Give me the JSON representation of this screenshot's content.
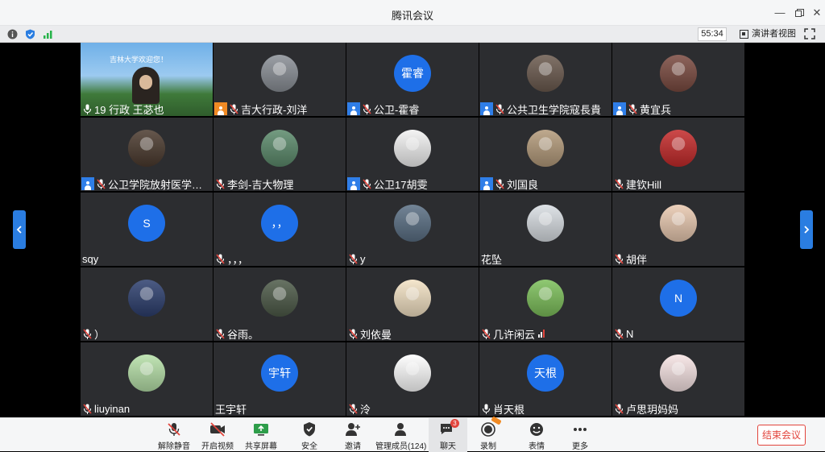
{
  "window": {
    "title": "腾讯会议"
  },
  "statusbar": {
    "timer": "55:34",
    "speaker_view_label": "演讲者视图"
  },
  "participants": [
    {
      "name": "19 行政 王苾也",
      "avatar_text": "",
      "avatar_kind": "video",
      "badge": "none",
      "mic": "on",
      "avatar_color": "#4a86c6",
      "video_banner": "吉林大学欢迎您！"
    },
    {
      "name": "吉大行政-刘洋",
      "avatar_text": "",
      "avatar_kind": "photo",
      "badge": "orange",
      "mic": "muted",
      "avatar_color": "#8a8f96"
    },
    {
      "name": "公卫-霍睿",
      "avatar_text": "霍睿",
      "avatar_kind": "text",
      "badge": "blue",
      "mic": "muted",
      "avatar_color": "#1e6fe8"
    },
    {
      "name": "公共卫生学院寇長貴",
      "avatar_text": "",
      "avatar_kind": "photo",
      "badge": "blue",
      "mic": "muted",
      "avatar_color": "#6b5a4e"
    },
    {
      "name": "黄宜兵",
      "avatar_text": "",
      "avatar_kind": "photo",
      "badge": "blue",
      "mic": "muted",
      "avatar_color": "#7a4a40"
    },
    {
      "name": "公卫学院放射医学…",
      "avatar_text": "",
      "avatar_kind": "photo",
      "badge": "blue",
      "mic": "muted",
      "avatar_color": "#4b3a2e"
    },
    {
      "name": "李剑-吉大物理",
      "avatar_text": "",
      "avatar_kind": "photo",
      "badge": "none",
      "mic": "muted",
      "avatar_color": "#5b8a6b"
    },
    {
      "name": "公卫17胡雯",
      "avatar_text": "",
      "avatar_kind": "photo",
      "badge": "blue",
      "mic": "muted",
      "avatar_color": "#f2f2f2"
    },
    {
      "name": "刘国良",
      "avatar_text": "",
      "avatar_kind": "photo",
      "badge": "blue",
      "mic": "muted",
      "avatar_color": "#b39a7a"
    },
    {
      "name": "建钦Hill",
      "avatar_text": "",
      "avatar_kind": "photo",
      "badge": "none",
      "mic": "muted",
      "avatar_color": "#c42a2a"
    },
    {
      "name": "sqy",
      "avatar_text": "S",
      "avatar_kind": "text",
      "badge": "none",
      "mic": "none",
      "avatar_color": "#1e6fe8"
    },
    {
      "name": "，，，",
      "avatar_text": "，，",
      "avatar_kind": "text",
      "badge": "none",
      "mic": "muted",
      "avatar_color": "#1e6fe8"
    },
    {
      "name": "y",
      "avatar_text": "",
      "avatar_kind": "photo",
      "badge": "none",
      "mic": "muted",
      "avatar_color": "#5a6f84"
    },
    {
      "name": "花坠",
      "avatar_text": "",
      "avatar_kind": "photo",
      "badge": "none",
      "mic": "none",
      "avatar_color": "#d9dee3"
    },
    {
      "name": "胡伴",
      "avatar_text": "",
      "avatar_kind": "photo",
      "badge": "none",
      "mic": "muted",
      "avatar_color": "#e9c9b0"
    },
    {
      "name": "）",
      "avatar_text": "",
      "avatar_kind": "photo",
      "badge": "none",
      "mic": "muted",
      "avatar_color": "#2d3f6e"
    },
    {
      "name": "谷雨。",
      "avatar_text": "",
      "avatar_kind": "photo",
      "badge": "none",
      "mic": "muted",
      "avatar_color": "#4d5a48"
    },
    {
      "name": "刘依曼",
      "avatar_text": "",
      "avatar_kind": "photo",
      "badge": "none",
      "mic": "muted",
      "avatar_color": "#f3e2c4"
    },
    {
      "name": "几许闲云",
      "avatar_text": "",
      "avatar_kind": "photo",
      "badge": "none",
      "mic": "muted",
      "avatar_color": "#7cbf5a",
      "signal": true
    },
    {
      "name": "N",
      "avatar_text": "N",
      "avatar_kind": "text",
      "badge": "none",
      "mic": "muted",
      "avatar_color": "#1e6fe8"
    },
    {
      "name": "liuyinan",
      "avatar_text": "",
      "avatar_kind": "photo",
      "badge": "none",
      "mic": "muted",
      "avatar_color": "#b6e0a8"
    },
    {
      "name": "王宇轩",
      "avatar_text": "宇轩",
      "avatar_kind": "text",
      "badge": "none",
      "mic": "none",
      "avatar_color": "#1e6fe8"
    },
    {
      "name": "泠",
      "avatar_text": "",
      "avatar_kind": "photo",
      "badge": "none",
      "mic": "muted",
      "avatar_color": "#ffffff"
    },
    {
      "name": "肖天根",
      "avatar_text": "天根",
      "avatar_kind": "text",
      "badge": "none",
      "mic": "on",
      "avatar_color": "#1e6fe8"
    },
    {
      "name": "卢思玥妈妈",
      "avatar_text": "",
      "avatar_kind": "photo",
      "badge": "none",
      "mic": "muted",
      "avatar_color": "#f7e4e4"
    }
  ],
  "toolbar": {
    "unmute": "解除静音",
    "start_video": "开启视频",
    "share_screen": "共享屏幕",
    "security": "安全",
    "invite": "邀请",
    "manage_members": "管理成员(124)",
    "chat": "聊天",
    "chat_badge": "3",
    "record": "录制",
    "reactions": "表情",
    "more": "更多",
    "end_meeting": "结束会议"
  },
  "colors": {
    "accent": "#2a7de1",
    "danger": "#e2443c",
    "tile": "#2c2d30"
  }
}
